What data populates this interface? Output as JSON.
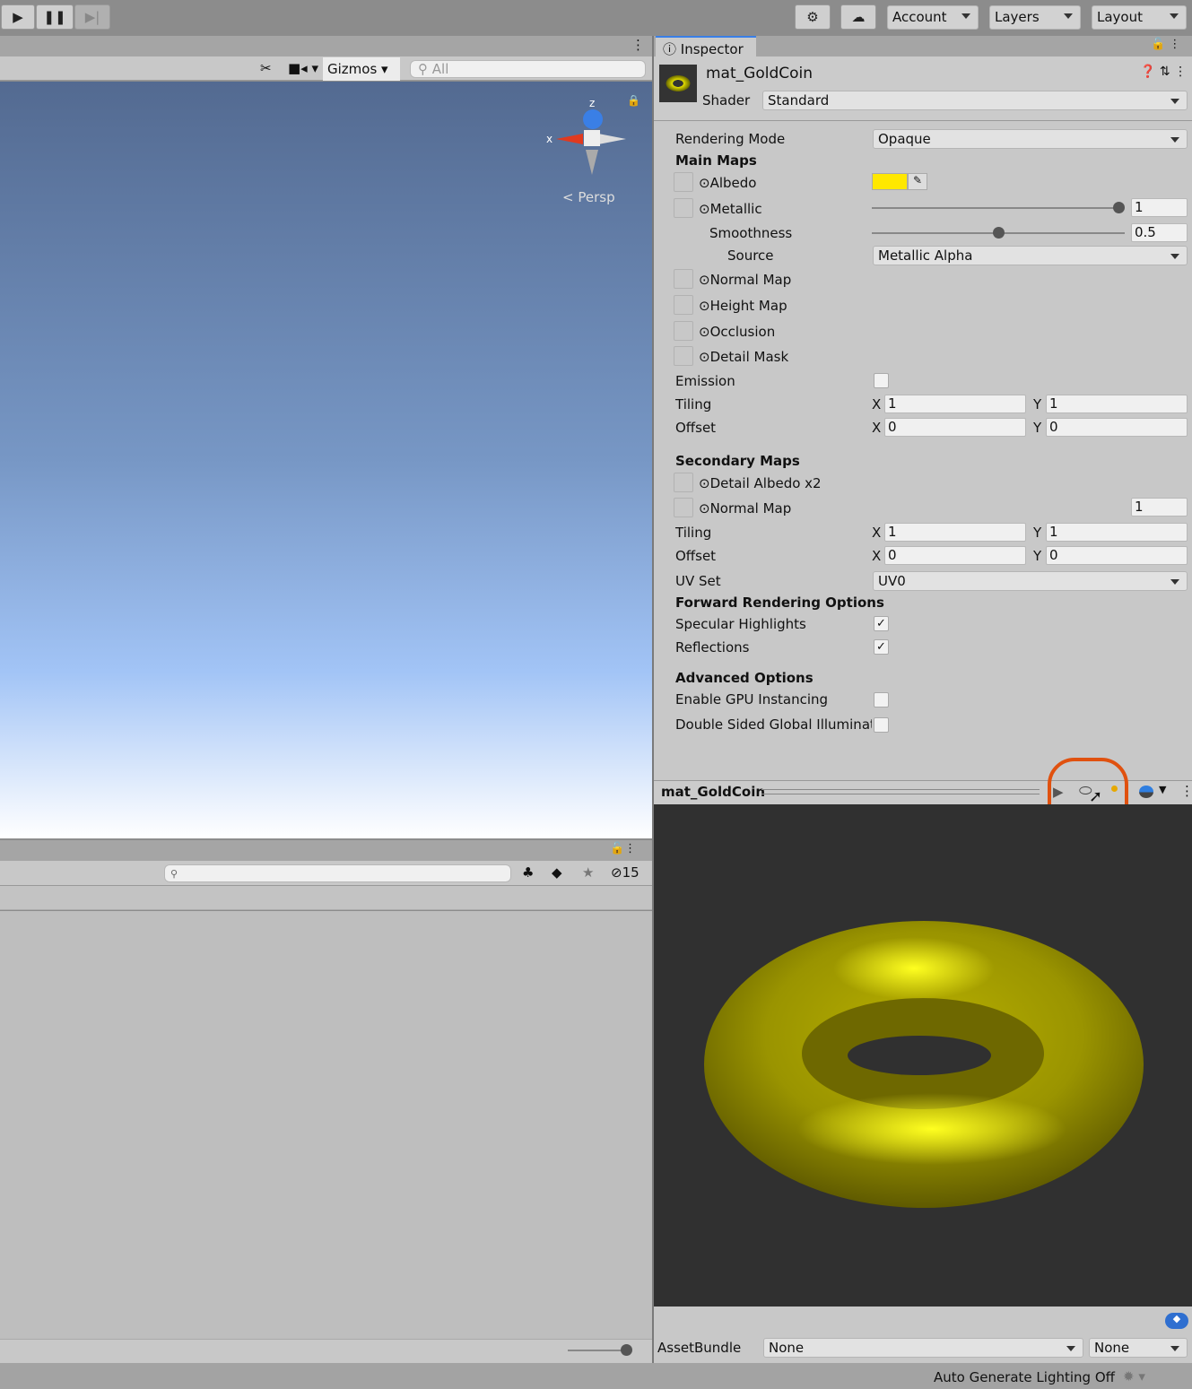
{
  "toolbar": {
    "account": "Account",
    "layers": "Layers",
    "layout": "Layout"
  },
  "scene": {
    "gizmos": "Gizmos",
    "search_placeholder": "All",
    "persp": "Persp",
    "axis_x": "x",
    "axis_z": "z"
  },
  "hierarchy": {
    "hidden_count": "15"
  },
  "inspector": {
    "tab": "Inspector",
    "material_name": "mat_GoldCoin",
    "shader_label": "Shader",
    "shader_value": "Standard",
    "rendering_mode_label": "Rendering Mode",
    "rendering_mode": "Opaque",
    "main_maps": "Main Maps",
    "albedo": "Albedo",
    "albedo_color": "#ffe800",
    "metallic": "Metallic",
    "metallic_value": "1",
    "metallic_level": 1,
    "smoothness": "Smoothness",
    "smoothness_value": "0.5",
    "smoothness_level": 0.5,
    "source": "Source",
    "source_value": "Metallic Alpha",
    "normal_map": "Normal Map",
    "height_map": "Height Map",
    "occlusion": "Occlusion",
    "detail_mask": "Detail Mask",
    "emission": "Emission",
    "tiling": "Tiling",
    "offset": "Offset",
    "x": "X",
    "y": "Y",
    "tiling_x": "1",
    "tiling_y": "1",
    "offset_x": "0",
    "offset_y": "0",
    "secondary_maps": "Secondary Maps",
    "detail_albedo": "Detail Albedo x2",
    "sec_normal_map": "Normal Map",
    "sec_normal_value": "1",
    "sec_tiling_x": "1",
    "sec_tiling_y": "1",
    "sec_offset_x": "0",
    "sec_offset_y": "0",
    "uv_set": "UV Set",
    "uv_set_value": "UV0",
    "forward_options": "Forward Rendering Options",
    "specular": "Specular Highlights",
    "reflections": "Reflections",
    "advanced": "Advanced Options",
    "gpu_instancing": "Enable GPU Instancing",
    "double_sided": "Double Sided Global Illuminati",
    "check": "✓"
  },
  "preview": {
    "title": "mat_GoldCoin",
    "highlight_color": "#e0510f"
  },
  "asset_bundle": {
    "label": "AssetBundle",
    "name": "None",
    "variant": "None"
  },
  "status": {
    "lighting": "Auto Generate Lighting Off"
  }
}
